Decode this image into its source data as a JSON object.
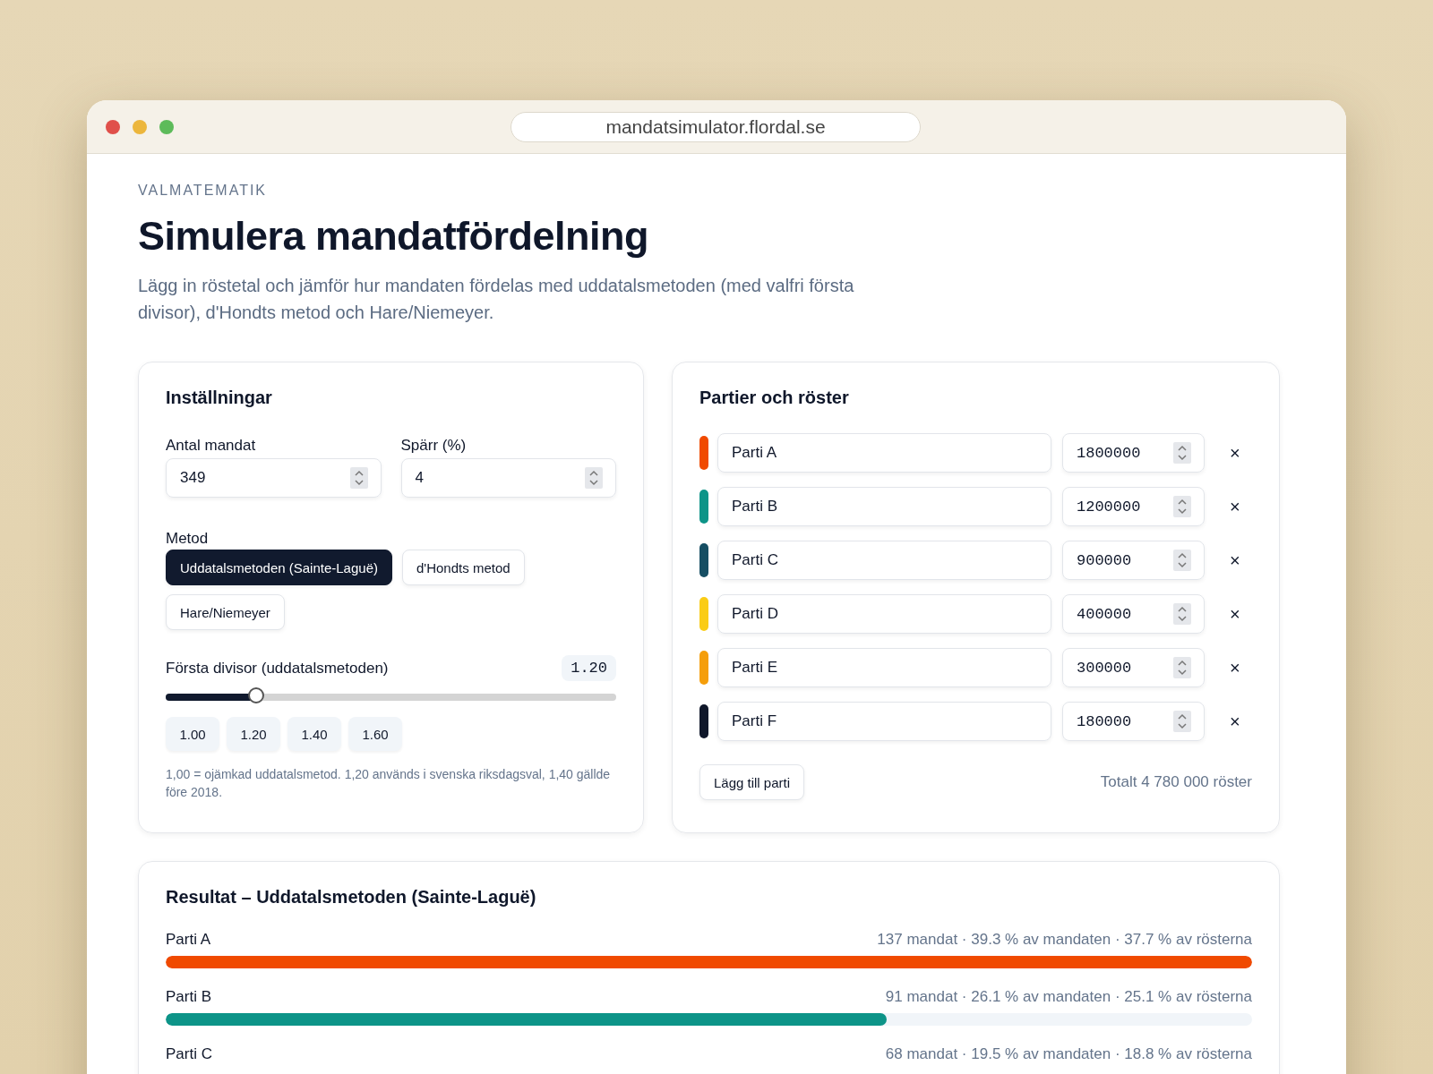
{
  "browser": {
    "url": "mandatsimulator.flordal.se"
  },
  "page": {
    "eyebrow": "VALMATEMATIK",
    "title": "Simulera mandatfördelning",
    "description": "Lägg in röstetal och jämför hur mandaten fördelas med uddatalsmetoden (med valfri första divisor), d'Hondts metod och Hare/Niemeyer."
  },
  "settings": {
    "title": "Inställningar",
    "fields": [
      {
        "label": "Antal mandat",
        "value": "349"
      },
      {
        "label": "Spärr (%)",
        "value": "4"
      }
    ],
    "method_label": "Metod",
    "methods": [
      {
        "label": "Uddatalsmetoden (Sainte-Laguë)",
        "selected": true
      },
      {
        "label": "d'Hondts metod",
        "selected": false
      },
      {
        "label": "Hare/Niemeyer",
        "selected": false
      }
    ],
    "divisor": {
      "label": "Första divisor (uddatalsmetoden)",
      "reading": "1.20",
      "level": 0.2
    },
    "presets": [
      "1.00",
      "1.20",
      "1.40",
      "1.60"
    ],
    "note": "1,00 = ojämkad uddatalsmetod. 1,20 används i svenska riksdagsval, 1,40 gällde före 2018."
  },
  "parties": {
    "title": "Partier och röster",
    "rows": [
      {
        "name": "Parti A",
        "votes": "1800000",
        "color": "#f04a00",
        "remove": "×"
      },
      {
        "name": "Parti B",
        "votes": "1200000",
        "color": "#0d9488",
        "remove": "×"
      },
      {
        "name": "Parti C",
        "votes": "900000",
        "color": "#164e63",
        "remove": "×"
      },
      {
        "name": "Parti D",
        "votes": "400000",
        "color": "#facc15",
        "remove": "×"
      },
      {
        "name": "Parti E",
        "votes": "300000",
        "color": "#f59e0b",
        "remove": "×"
      },
      {
        "name": "Parti F",
        "votes": "180000",
        "color": "#0f172a",
        "remove": "×"
      }
    ],
    "add_button": "Lägg till parti",
    "total": "Totalt 4 780 000 röster"
  },
  "results": {
    "title": "Resultat – Uddatalsmetoden (Sainte-Laguë)",
    "rows": [
      {
        "name": "Parti A",
        "summary": "137 mandat · 39.3 % av mandaten · 37.7 % av rösterna",
        "level": 1.0,
        "color": "#f04a00"
      },
      {
        "name": "Parti B",
        "summary": "91 mandat · 26.1 % av mandaten · 25.1 % av rösterna",
        "level": 0.664,
        "color": "#0d9488"
      },
      {
        "name": "Parti C",
        "summary": "68 mandat · 19.5 % av mandaten · 18.8 % av rösterna"
      }
    ]
  }
}
